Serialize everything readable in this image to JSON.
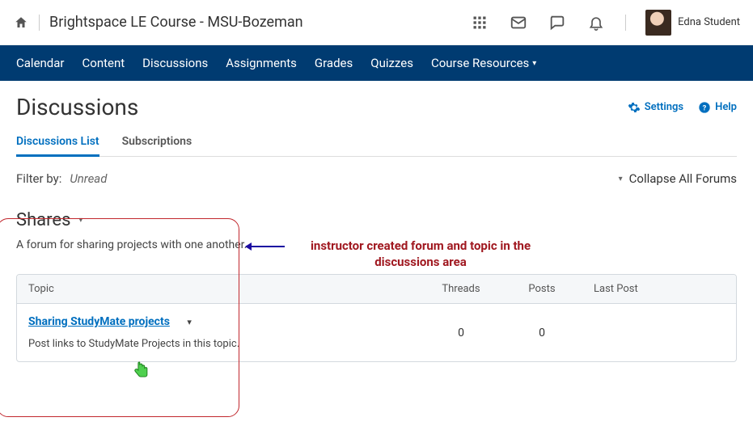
{
  "header": {
    "course_title": "Brightspace LE Course - MSU-Bozeman",
    "user_name": "Edna Student"
  },
  "nav": {
    "items": [
      "Calendar",
      "Content",
      "Discussions",
      "Assignments",
      "Grades",
      "Quizzes"
    ],
    "dropdown": "Course Resources"
  },
  "page": {
    "title": "Discussions",
    "settings_label": "Settings",
    "help_label": "Help"
  },
  "tabs": {
    "active": "Discussions List",
    "other": "Subscriptions"
  },
  "filter": {
    "label": "Filter by:",
    "value": "Unread",
    "collapse": "Collapse All Forums"
  },
  "forum": {
    "title": "Shares",
    "description": "A forum for sharing projects with one another."
  },
  "table": {
    "headers": {
      "topic": "Topic",
      "threads": "Threads",
      "posts": "Posts",
      "last": "Last Post"
    },
    "row": {
      "title": "Sharing StudyMate projects",
      "desc": "Post links to StudyMate Projects in this topic.",
      "threads": "0",
      "posts": "0",
      "last": ""
    }
  },
  "annotation": {
    "text": "instructor created forum and topic in the discussions area"
  }
}
